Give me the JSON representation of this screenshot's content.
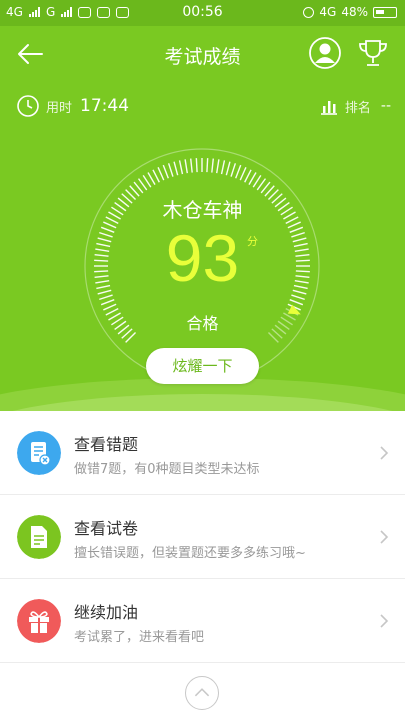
{
  "status_bar": {
    "net1": "4G",
    "net2": "G",
    "time": "00:56",
    "net3": "4G",
    "battery": "48%"
  },
  "header": {
    "title": "考试成绩"
  },
  "stats": {
    "time_label": "用时",
    "time_value": "17:44",
    "rank_label": "排名",
    "rank_value": "--"
  },
  "result": {
    "rank_title": "木仓车神",
    "score": "93",
    "score_unit": "分",
    "pass_label": "合格",
    "share_label": "炫耀一下",
    "score_fraction": 0.93
  },
  "items": [
    {
      "title": "查看错题",
      "subtitle": "做错7题，有0种题目类型未达标",
      "icon": "wrong-questions-icon",
      "color": "#3da8ee"
    },
    {
      "title": "查看试卷",
      "subtitle": "擅长错误题，但装置题还要多多练习哦~",
      "icon": "paper-icon",
      "color": "#7cc520"
    },
    {
      "title": "继续加油",
      "subtitle": "考试累了，进来看看吧",
      "icon": "gift-icon",
      "color": "#f05a5a"
    }
  ],
  "colors": {
    "brand": "#7ac922",
    "score": "#e8ff3a"
  }
}
